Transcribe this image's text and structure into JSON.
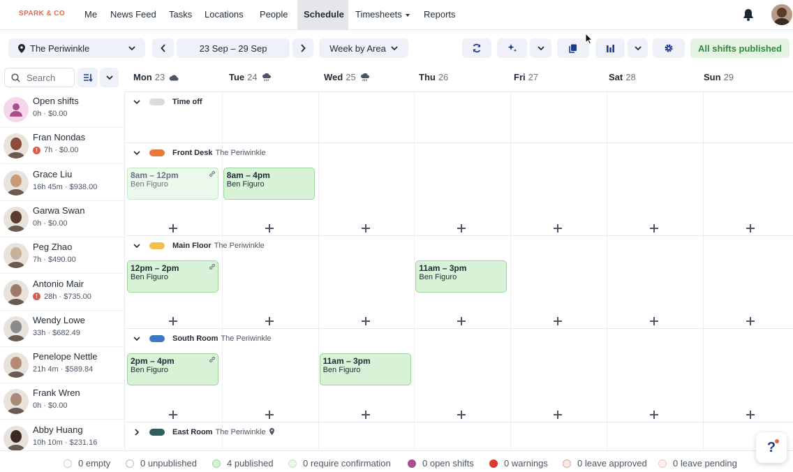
{
  "brand": "SPARK & CO",
  "nav": {
    "items": [
      "Me",
      "News Feed",
      "Tasks",
      "Locations",
      "People",
      "Schedule",
      "Timesheets",
      "Reports"
    ],
    "active": "Schedule"
  },
  "toolbar": {
    "location": "The Periwinkle",
    "date_range": "23 Sep – 29 Sep",
    "view": "Week by Area",
    "publish_status": "All shifts published"
  },
  "search": {
    "placeholder": "Search"
  },
  "days": [
    {
      "name": "Mon",
      "num": "23",
      "weather": "cloud"
    },
    {
      "name": "Tue",
      "num": "24",
      "weather": "rain"
    },
    {
      "name": "Wed",
      "num": "25",
      "weather": "rain"
    },
    {
      "name": "Thu",
      "num": "26",
      "weather": ""
    },
    {
      "name": "Fri",
      "num": "27",
      "weather": ""
    },
    {
      "name": "Sat",
      "num": "28",
      "weather": ""
    },
    {
      "name": "Sun",
      "num": "29",
      "weather": ""
    }
  ],
  "people": [
    {
      "name": "Open shifts",
      "meta": "0h · $0.00",
      "warning": false,
      "avatar_color": "#f6d6ea"
    },
    {
      "name": "Fran Nondas",
      "meta": "7h · $0.00",
      "warning": true,
      "avatar_color": "#8a4b3a"
    },
    {
      "name": "Grace Liu",
      "meta": "16h 45m · $938.00",
      "warning": false,
      "avatar_color": "#c99a7a"
    },
    {
      "name": "Garwa Swan",
      "meta": "0h · $0.00",
      "warning": false,
      "avatar_color": "#5a3d2b"
    },
    {
      "name": "Peg Zhao",
      "meta": "7h · $490.00",
      "warning": false,
      "avatar_color": "#c8b09a"
    },
    {
      "name": "Antonio Mair",
      "meta": "28h · $735.00",
      "warning": true,
      "avatar_color": "#9c7c68"
    },
    {
      "name": "Wendy Lowe",
      "meta": "33h · $682.49",
      "warning": false,
      "avatar_color": "#8a8a8a"
    },
    {
      "name": "Penelope Nettle",
      "meta": "21h 4m · $589.84",
      "warning": false,
      "avatar_color": "#b58a78"
    },
    {
      "name": "Frank Wren",
      "meta": "0h · $0.00",
      "warning": false,
      "avatar_color": "#a78b76"
    },
    {
      "name": "Abby Huang",
      "meta": "10h 10m · $231.16",
      "warning": false,
      "avatar_color": "#3b2a22"
    }
  ],
  "sections": [
    {
      "title": "Time off",
      "sub": "",
      "color": "#d9dbde",
      "expanded": true
    },
    {
      "title": "Front Desk",
      "sub": "The Periwinkle",
      "color": "#e67a3c",
      "expanded": true
    },
    {
      "title": "Main Floor",
      "sub": "The Periwinkle",
      "color": "#f2c04e",
      "expanded": true
    },
    {
      "title": "South Room",
      "sub": "The Periwinkle",
      "color": "#3c78c3",
      "expanded": true
    },
    {
      "title": "East Room",
      "sub": "The Periwinkle",
      "color": "#2e5e5e",
      "expanded": false
    }
  ],
  "shifts": [
    {
      "time": "8am – 12pm",
      "name": "Ben Figuro",
      "style": "light",
      "link": true
    },
    {
      "time": "8am – 4pm",
      "name": "Ben Figuro",
      "style": "normal",
      "link": false
    },
    {
      "time": "12pm – 2pm",
      "name": "Ben Figuro",
      "style": "normal",
      "link": true
    },
    {
      "time": "11am – 3pm",
      "name": "Ben Figuro",
      "style": "normal",
      "link": false
    },
    {
      "time": "2pm – 4pm",
      "name": "Ben Figuro",
      "style": "normal",
      "link": true
    },
    {
      "time": "11am – 3pm",
      "name": "Ben Figuro",
      "style": "normal",
      "link": false
    }
  ],
  "footer": [
    {
      "label": "0 empty",
      "color": "#ffffff",
      "border": "#c8ccd1"
    },
    {
      "label": "0 unpublished",
      "color": "#ffffff",
      "border": "#b8bcc1"
    },
    {
      "label": "4 published",
      "color": "#d7f2d7",
      "border": "#9ad49a"
    },
    {
      "label": "0 require confirmation",
      "color": "#ebf8eb",
      "border": "#c4e8c4"
    },
    {
      "label": "0 open shifts",
      "color": "#a8508a",
      "border": "#a8508a"
    },
    {
      "label": "0 warnings",
      "color": "#d93a2b",
      "border": "#d93a2b"
    },
    {
      "label": "0 leave approved",
      "color": "#fbeaea",
      "border": "#e6a3a3"
    },
    {
      "label": "0 leave pending",
      "color": "#fdf1f1",
      "border": "#ecc5c5"
    }
  ]
}
